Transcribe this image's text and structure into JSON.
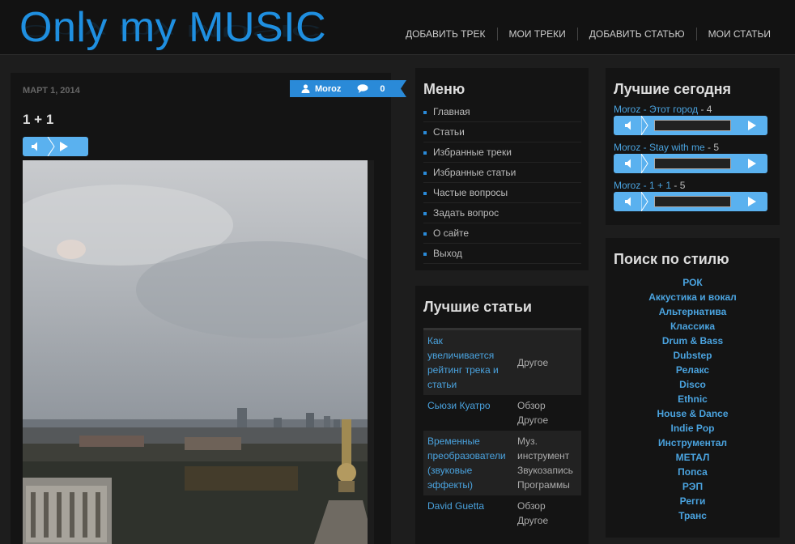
{
  "header": {
    "logo": "Only my MUSIC",
    "nav": [
      "ДОБАВИТЬ ТРЕК",
      "МОИ ТРЕКИ",
      "ДОБАВИТЬ СТАТЬЮ",
      "МОИ СТАТЬИ"
    ]
  },
  "post": {
    "date": "МАРТ 1, 2014",
    "author": "Moroz",
    "comments": "0",
    "title": "1 + 1"
  },
  "menu": {
    "title": "Меню",
    "items": [
      "Главная",
      "Статьи",
      "Избранные треки",
      "Избранные статьи",
      "Частые вопросы",
      "Задать вопрос",
      "О сайте",
      "Выход"
    ]
  },
  "articles": {
    "title": "Лучшие статьи",
    "rows": [
      {
        "title": "Как увеличивается рейтинг трека и статьи",
        "category": "Другое"
      },
      {
        "title": "Сьюзи Куатро",
        "category": "Обзор Другое"
      },
      {
        "title": "Временные преобразователи (звуковые эффекты)",
        "category": "Муз. инструмент Звукозапись Программы"
      },
      {
        "title": "David Guetta",
        "category": "Обзор Другое"
      }
    ]
  },
  "today": {
    "title": "Лучшие сегодня",
    "tracks": [
      {
        "author": "Moroz",
        "sep": " - ",
        "name": "Этот город",
        "score": " - 4"
      },
      {
        "author": "Moroz",
        "sep": " - ",
        "name": "Stay with me",
        "score": " - 5"
      },
      {
        "author": "Moroz",
        "sep": " - ",
        "name": "1 + 1",
        "score": " - 5"
      }
    ]
  },
  "styles": {
    "title": "Поиск по стилю",
    "items": [
      "РОК",
      "Аккустика и вокал",
      "Альтернатива",
      "Классика",
      "Drum & Bass",
      "Dubstep",
      "Релакс",
      "Disco",
      "Ethnic",
      "House & Dance",
      "Indie Pop",
      "Инструментал",
      "МЕТАЛ",
      "Попса",
      "РЭП",
      "Регги",
      "Транс"
    ]
  },
  "colors": {
    "accent": "#2a8ad8",
    "player": "#5ab1ef",
    "link": "#4aa3df"
  },
  "icons": [
    "user-icon",
    "comment-icon",
    "volume-icon",
    "play-icon"
  ]
}
